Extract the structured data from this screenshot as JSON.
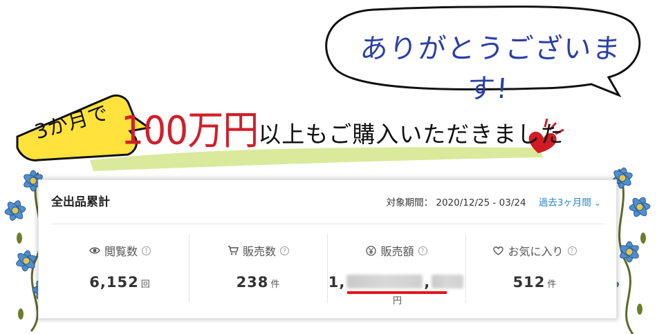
{
  "banner": {
    "bubble_text": "ありがとうございます!",
    "badge_text": "3か月で",
    "headline_amount": "100万円",
    "headline_rest": "以上もご購入いただきました"
  },
  "card": {
    "title": "全出品累計",
    "period_label": "対象期間：",
    "period_value": "2020/12/25 - 03/24",
    "range_select": "過去3ヶ月間",
    "help_glyph": "?"
  },
  "stats": [
    {
      "icon": "eye-icon",
      "label": "閲覧数",
      "value": "6,152",
      "unit": "回"
    },
    {
      "icon": "cart-icon",
      "label": "販売数",
      "value": "238",
      "unit": "件"
    },
    {
      "icon": "yen-icon",
      "label": "販売額",
      "value_prefix": "1,",
      "value_suffix": ",",
      "unit": "円"
    },
    {
      "icon": "heart-icon",
      "label": "お気に入り",
      "value": "512",
      "unit": "件"
    }
  ],
  "colors": {
    "accent_red": "#e6141c",
    "link_blue": "#2b86c5",
    "bubble_blue": "#2b3fa8",
    "flower_blue": "#4f8fd0"
  }
}
